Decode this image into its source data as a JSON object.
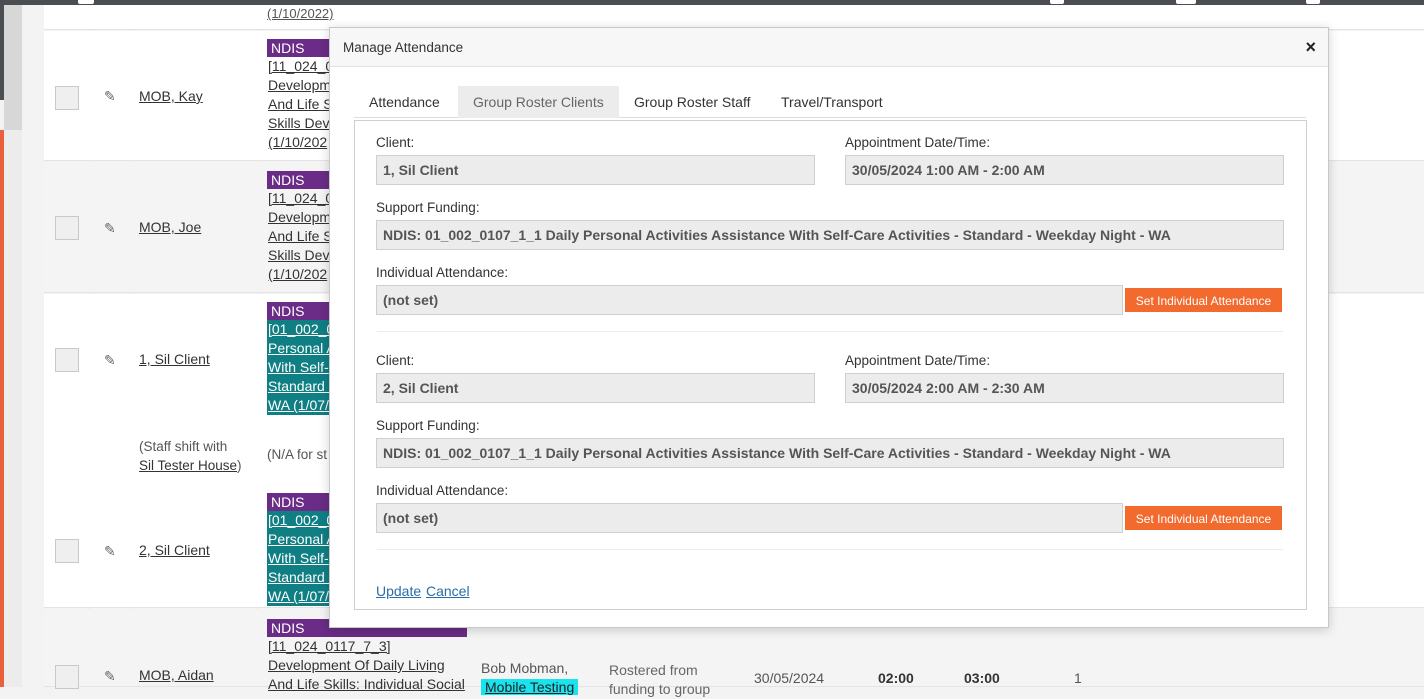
{
  "background_rows": [
    {
      "client": "MOB, Kay",
      "funding_badge": "NDIS",
      "funding_lines": [
        "[11_024_0",
        "Developm",
        "And Life S",
        "Skills Deve",
        "(1/10/202"
      ]
    },
    {
      "client": "MOB, Joe",
      "funding_badge": "NDIS",
      "funding_lines": [
        "[11_024_0",
        "Developm",
        "And Life S",
        "Skills Deve",
        "(1/10/202"
      ]
    },
    {
      "client": "1, Sil Client",
      "funding_badge": "NDIS",
      "funding_lines": [
        "[01_002_0",
        "Personal A",
        "With Self-",
        "Standard -",
        "WA (1/07/"
      ]
    },
    {
      "client": "2, Sil Client",
      "funding_badge": "NDIS",
      "funding_lines": [
        "[01_002_0",
        "Personal A",
        "With Self-",
        "Standard -",
        "WA (1/07/"
      ]
    },
    {
      "client": "MOB, Aidan",
      "funding_badge": "NDIS",
      "funding_lines": [
        "[11_024_0117_7_3]",
        "Development Of Daily Living",
        "And Life Skills: Individual Social"
      ],
      "staff": "Bob Mobman,",
      "staff_badge": "Mobile Testing",
      "status": "Rostered from",
      "status2": "funding to group",
      "date": "30/05/2024",
      "start": "02:00",
      "end": "03:00",
      "count": "1"
    }
  ],
  "top_partial_text": "(1/10/2022)",
  "shift_note": {
    "prefix": "(Staff shift with",
    "link": "Sil Tester House",
    "suffix": ")"
  },
  "na_note": "(N/A for st",
  "modal": {
    "title": "Manage Attendance",
    "close": "×",
    "tabs": [
      "Attendance",
      "Group Roster Clients",
      "Group Roster Staff",
      "Travel/Transport"
    ],
    "active_tab": 1,
    "labels": {
      "client": "Client:",
      "appointment": "Appointment Date/Time:",
      "funding": "Support Funding:",
      "attendance": "Individual Attendance:"
    },
    "set_button": "Set Individual Attendance",
    "clients": [
      {
        "client": "1, Sil Client",
        "appointment": "30/05/2024 1:00 AM - 2:00 AM",
        "funding": "NDIS: 01_002_0107_1_1 Daily Personal Activities Assistance With Self-Care Activities - Standard - Weekday Night - WA",
        "attendance": "(not set)"
      },
      {
        "client": "2, Sil Client",
        "appointment": "30/05/2024 2:00 AM - 2:30 AM",
        "funding": "NDIS: 01_002_0107_1_1 Daily Personal Activities Assistance With Self-Care Activities - Standard - Weekday Night - WA",
        "attendance": "(not set)"
      }
    ],
    "update": "Update",
    "cancel": "Cancel"
  },
  "colors": {
    "ndis": "#6a2c86",
    "teal": "#0f7f84",
    "orange": "#f26a2e",
    "cyan": "#19e3ee"
  }
}
